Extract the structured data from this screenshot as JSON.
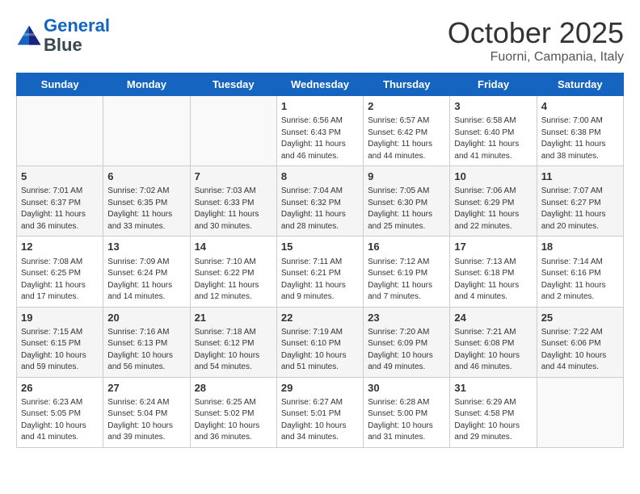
{
  "logo": {
    "line1": "General",
    "line2": "Blue"
  },
  "title": "October 2025",
  "location": "Fuorni, Campania, Italy",
  "weekdays": [
    "Sunday",
    "Monday",
    "Tuesday",
    "Wednesday",
    "Thursday",
    "Friday",
    "Saturday"
  ],
  "weeks": [
    [
      {
        "day": "",
        "info": ""
      },
      {
        "day": "",
        "info": ""
      },
      {
        "day": "",
        "info": ""
      },
      {
        "day": "1",
        "info": "Sunrise: 6:56 AM\nSunset: 6:43 PM\nDaylight: 11 hours\nand 46 minutes."
      },
      {
        "day": "2",
        "info": "Sunrise: 6:57 AM\nSunset: 6:42 PM\nDaylight: 11 hours\nand 44 minutes."
      },
      {
        "day": "3",
        "info": "Sunrise: 6:58 AM\nSunset: 6:40 PM\nDaylight: 11 hours\nand 41 minutes."
      },
      {
        "day": "4",
        "info": "Sunrise: 7:00 AM\nSunset: 6:38 PM\nDaylight: 11 hours\nand 38 minutes."
      }
    ],
    [
      {
        "day": "5",
        "info": "Sunrise: 7:01 AM\nSunset: 6:37 PM\nDaylight: 11 hours\nand 36 minutes."
      },
      {
        "day": "6",
        "info": "Sunrise: 7:02 AM\nSunset: 6:35 PM\nDaylight: 11 hours\nand 33 minutes."
      },
      {
        "day": "7",
        "info": "Sunrise: 7:03 AM\nSunset: 6:33 PM\nDaylight: 11 hours\nand 30 minutes."
      },
      {
        "day": "8",
        "info": "Sunrise: 7:04 AM\nSunset: 6:32 PM\nDaylight: 11 hours\nand 28 minutes."
      },
      {
        "day": "9",
        "info": "Sunrise: 7:05 AM\nSunset: 6:30 PM\nDaylight: 11 hours\nand 25 minutes."
      },
      {
        "day": "10",
        "info": "Sunrise: 7:06 AM\nSunset: 6:29 PM\nDaylight: 11 hours\nand 22 minutes."
      },
      {
        "day": "11",
        "info": "Sunrise: 7:07 AM\nSunset: 6:27 PM\nDaylight: 11 hours\nand 20 minutes."
      }
    ],
    [
      {
        "day": "12",
        "info": "Sunrise: 7:08 AM\nSunset: 6:25 PM\nDaylight: 11 hours\nand 17 minutes."
      },
      {
        "day": "13",
        "info": "Sunrise: 7:09 AM\nSunset: 6:24 PM\nDaylight: 11 hours\nand 14 minutes."
      },
      {
        "day": "14",
        "info": "Sunrise: 7:10 AM\nSunset: 6:22 PM\nDaylight: 11 hours\nand 12 minutes."
      },
      {
        "day": "15",
        "info": "Sunrise: 7:11 AM\nSunset: 6:21 PM\nDaylight: 11 hours\nand 9 minutes."
      },
      {
        "day": "16",
        "info": "Sunrise: 7:12 AM\nSunset: 6:19 PM\nDaylight: 11 hours\nand 7 minutes."
      },
      {
        "day": "17",
        "info": "Sunrise: 7:13 AM\nSunset: 6:18 PM\nDaylight: 11 hours\nand 4 minutes."
      },
      {
        "day": "18",
        "info": "Sunrise: 7:14 AM\nSunset: 6:16 PM\nDaylight: 11 hours\nand 2 minutes."
      }
    ],
    [
      {
        "day": "19",
        "info": "Sunrise: 7:15 AM\nSunset: 6:15 PM\nDaylight: 10 hours\nand 59 minutes."
      },
      {
        "day": "20",
        "info": "Sunrise: 7:16 AM\nSunset: 6:13 PM\nDaylight: 10 hours\nand 56 minutes."
      },
      {
        "day": "21",
        "info": "Sunrise: 7:18 AM\nSunset: 6:12 PM\nDaylight: 10 hours\nand 54 minutes."
      },
      {
        "day": "22",
        "info": "Sunrise: 7:19 AM\nSunset: 6:10 PM\nDaylight: 10 hours\nand 51 minutes."
      },
      {
        "day": "23",
        "info": "Sunrise: 7:20 AM\nSunset: 6:09 PM\nDaylight: 10 hours\nand 49 minutes."
      },
      {
        "day": "24",
        "info": "Sunrise: 7:21 AM\nSunset: 6:08 PM\nDaylight: 10 hours\nand 46 minutes."
      },
      {
        "day": "25",
        "info": "Sunrise: 7:22 AM\nSunset: 6:06 PM\nDaylight: 10 hours\nand 44 minutes."
      }
    ],
    [
      {
        "day": "26",
        "info": "Sunrise: 6:23 AM\nSunset: 5:05 PM\nDaylight: 10 hours\nand 41 minutes."
      },
      {
        "day": "27",
        "info": "Sunrise: 6:24 AM\nSunset: 5:04 PM\nDaylight: 10 hours\nand 39 minutes."
      },
      {
        "day": "28",
        "info": "Sunrise: 6:25 AM\nSunset: 5:02 PM\nDaylight: 10 hours\nand 36 minutes."
      },
      {
        "day": "29",
        "info": "Sunrise: 6:27 AM\nSunset: 5:01 PM\nDaylight: 10 hours\nand 34 minutes."
      },
      {
        "day": "30",
        "info": "Sunrise: 6:28 AM\nSunset: 5:00 PM\nDaylight: 10 hours\nand 31 minutes."
      },
      {
        "day": "31",
        "info": "Sunrise: 6:29 AM\nSunset: 4:58 PM\nDaylight: 10 hours\nand 29 minutes."
      },
      {
        "day": "",
        "info": ""
      }
    ]
  ]
}
